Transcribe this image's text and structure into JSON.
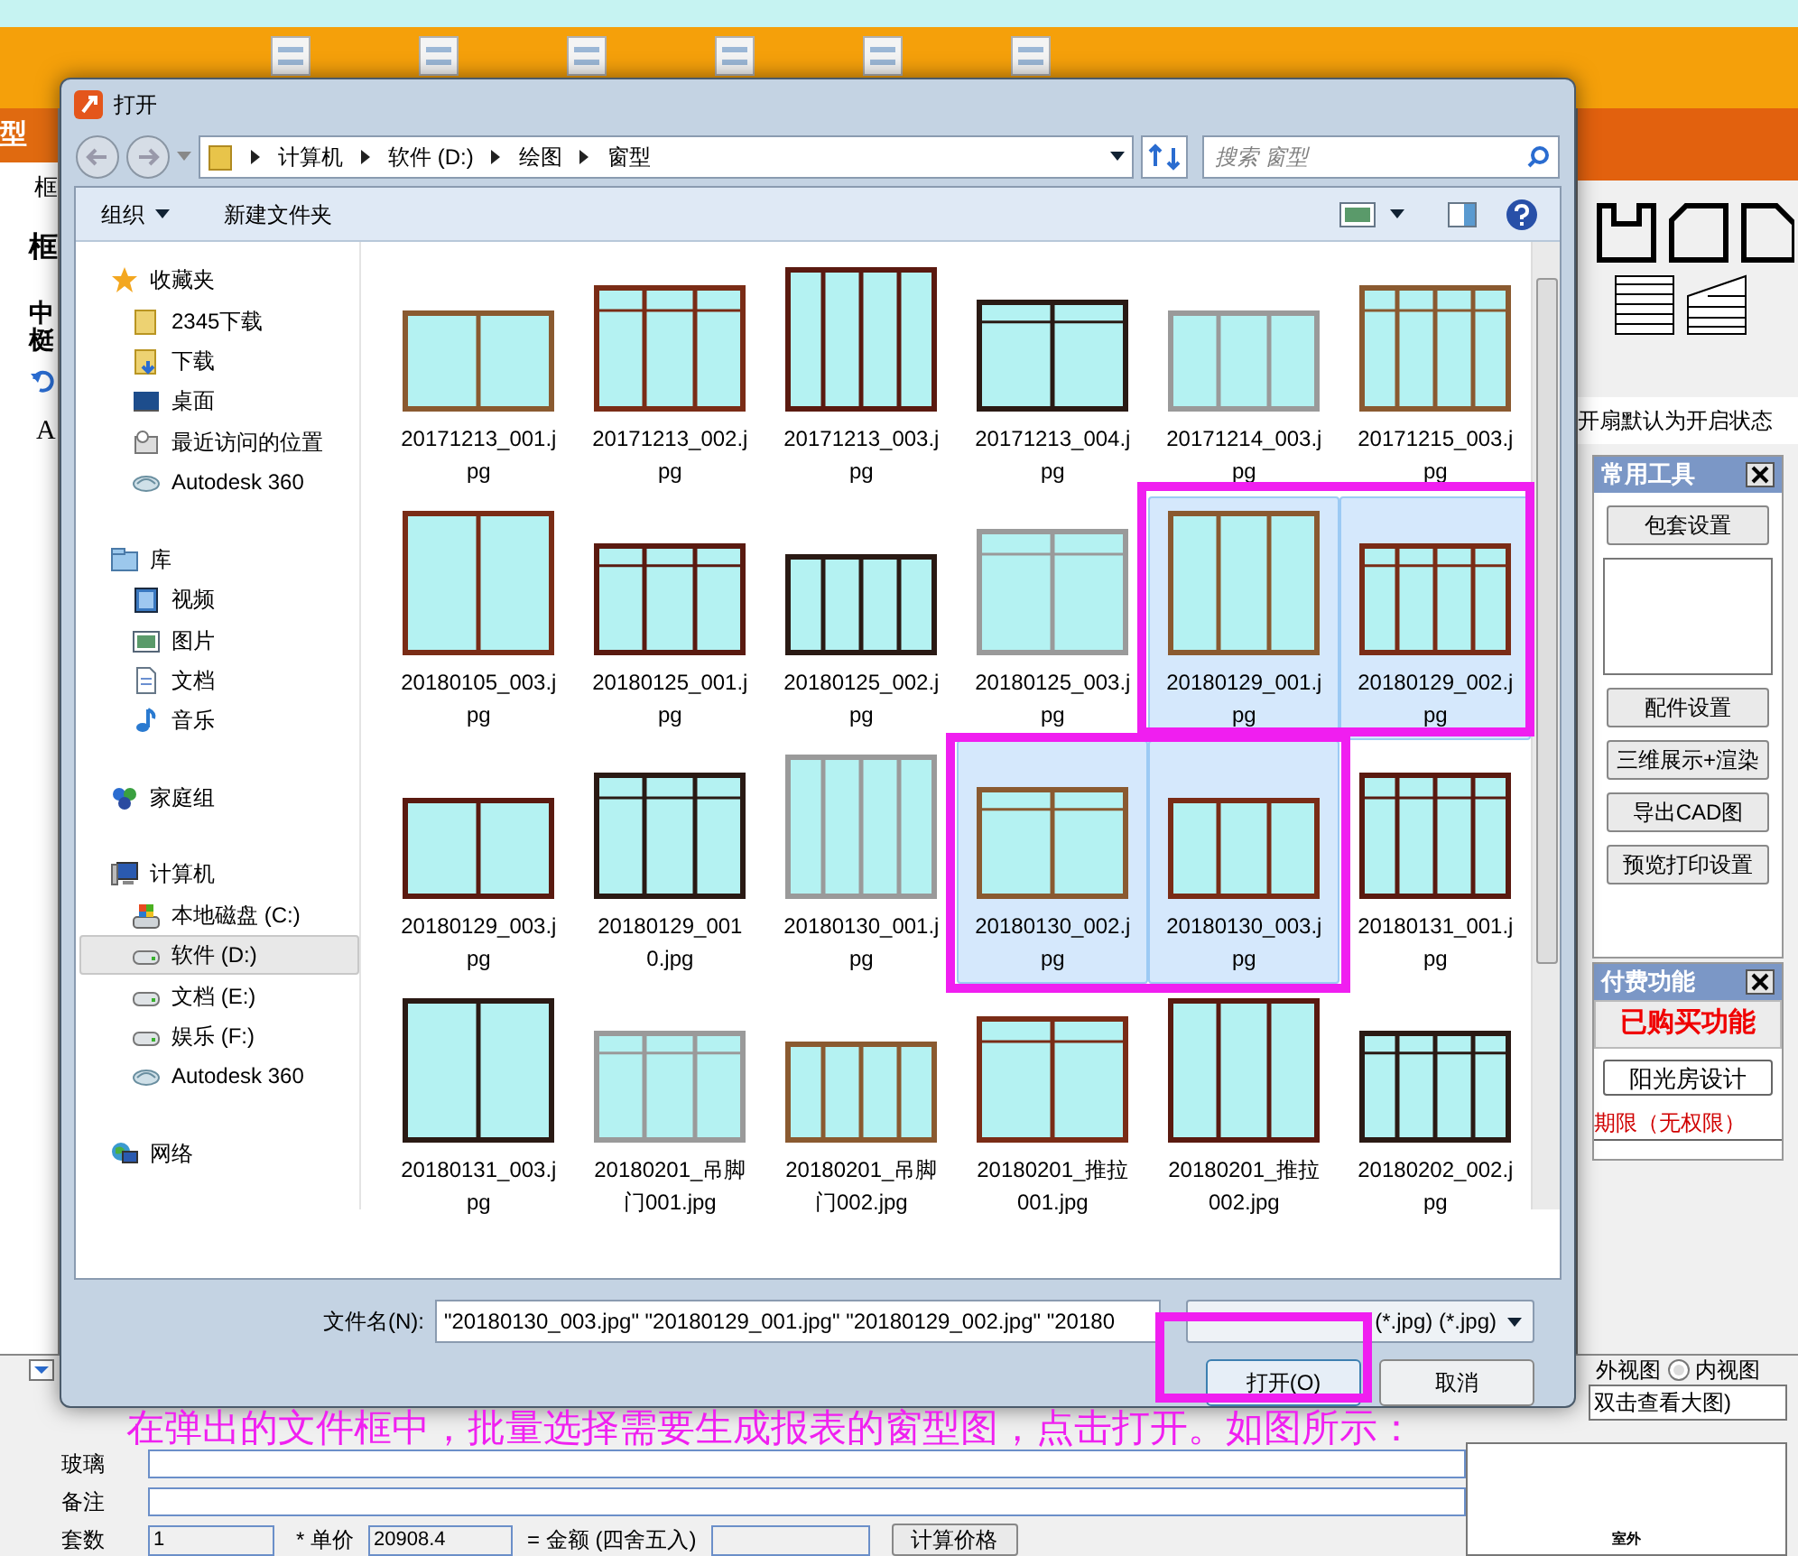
{
  "app": {
    "header_title": "型",
    "left_tab": "框",
    "left_heading": "框",
    "left_sub": "中梃",
    "font_label": "A",
    "hint": "开扇默认为开启状态",
    "tools_panel": {
      "title": "常用工具",
      "buttons": [
        "包套设置",
        "配件设置",
        "三维展示+渲染",
        "导出CAD图",
        "预览打印设置"
      ]
    },
    "paid_panel": {
      "title": "付费功能",
      "status": "已购买功能",
      "button": "阳光房设计",
      "term": "期限（无权限）"
    },
    "outer_view_label": "外视图",
    "inner_view": {
      "label": "内视图",
      "selected": false
    },
    "preview_hint": "双击查看大图)",
    "preview_caption": "室外",
    "form": {
      "glass_label": "玻璃",
      "note_label": "备注",
      "qty_label": "套数",
      "qty": "1",
      "price_label": "* 单价",
      "price": "20908.4",
      "amount_label": "= 金额 (四舍五入)",
      "calc_button": "计算价格"
    }
  },
  "dialog": {
    "title": "打开",
    "breadcrumb": [
      "计算机",
      "软件 (D:)",
      "绘图",
      "窗型"
    ],
    "search_placeholder": "搜索 窗型",
    "organize": "组织",
    "new_folder": "新建文件夹",
    "nav": [
      {
        "label": "收藏夹",
        "kind": "star",
        "selected": false,
        "children": [
          {
            "label": "2345下载",
            "kind": "folder",
            "selected": false
          },
          {
            "label": "下载",
            "kind": "download",
            "selected": false
          },
          {
            "label": "桌面",
            "kind": "desktop",
            "selected": false
          },
          {
            "label": "最近访问的位置",
            "kind": "recent",
            "selected": false
          },
          {
            "label": "Autodesk 360",
            "kind": "cloud",
            "selected": false
          }
        ]
      },
      {
        "label": "库",
        "kind": "library",
        "selected": false,
        "children": [
          {
            "label": "视频",
            "kind": "video",
            "selected": false
          },
          {
            "label": "图片",
            "kind": "picture",
            "selected": false
          },
          {
            "label": "文档",
            "kind": "document",
            "selected": false
          },
          {
            "label": "音乐",
            "kind": "music",
            "selected": false
          }
        ]
      },
      {
        "label": "家庭组",
        "kind": "homegroup",
        "selected": false
      },
      {
        "label": "计算机",
        "kind": "computer",
        "selected": false,
        "children": [
          {
            "label": "本地磁盘 (C:)",
            "kind": "system-disk",
            "selected": false
          },
          {
            "label": "软件 (D:)",
            "kind": "disk",
            "selected": true
          },
          {
            "label": "文档 (E:)",
            "kind": "disk",
            "selected": false
          },
          {
            "label": "娱乐 (F:)",
            "kind": "disk",
            "selected": false
          },
          {
            "label": "Autodesk 360",
            "kind": "cloud",
            "selected": false
          }
        ]
      },
      {
        "label": "网络",
        "kind": "network",
        "selected": false
      }
    ],
    "files": [
      {
        "name": "20171213_001.jpg",
        "selected": false
      },
      {
        "name": "20171213_002.jpg",
        "selected": false
      },
      {
        "name": "20171213_003.jpg",
        "selected": false
      },
      {
        "name": "20171213_004.jpg",
        "selected": false
      },
      {
        "name": "20171214_003.jpg",
        "selected": false
      },
      {
        "name": "20171215_003.jpg",
        "selected": false
      },
      {
        "name": "20180105_003.jpg",
        "selected": false
      },
      {
        "name": "20180125_001.jpg",
        "selected": false
      },
      {
        "name": "20180125_002.jpg",
        "selected": false
      },
      {
        "name": "20180125_003.jpg",
        "selected": false
      },
      {
        "name": "20180129_001.jpg",
        "selected": true
      },
      {
        "name": "20180129_002.jpg",
        "selected": true
      },
      {
        "name": "20180129_003.jpg",
        "selected": false
      },
      {
        "name": "20180129_0010.jpg",
        "selected": false
      },
      {
        "name": "20180130_001.jpg",
        "selected": false
      },
      {
        "name": "20180130_002.jpg",
        "selected": true
      },
      {
        "name": "20180130_003.jpg",
        "selected": true
      },
      {
        "name": "20180131_001.jpg",
        "selected": false
      },
      {
        "name": "20180131_003.jpg",
        "selected": false
      },
      {
        "name": "20180201_吊脚门001.jpg",
        "selected": false
      },
      {
        "name": "20180201_吊脚门002.jpg",
        "selected": false
      },
      {
        "name": "20180201_推拉001.jpg",
        "selected": false
      },
      {
        "name": "20180201_推拉002.jpg",
        "selected": false
      },
      {
        "name": "20180202_002.jpg",
        "selected": false
      }
    ],
    "filename_label": "文件名(N):",
    "filename_value": "\"20180130_003.jpg\" \"20180129_001.jpg\" \"20180129_002.jpg\" \"20180",
    "filetype": "(*.jpg) (*.jpg)",
    "open_button": "打开(O)",
    "cancel_button": "取消"
  },
  "annotation": "在弹出的文件框中，批量选择需要生成报表的窗型图，点击打开。如图所示："
}
